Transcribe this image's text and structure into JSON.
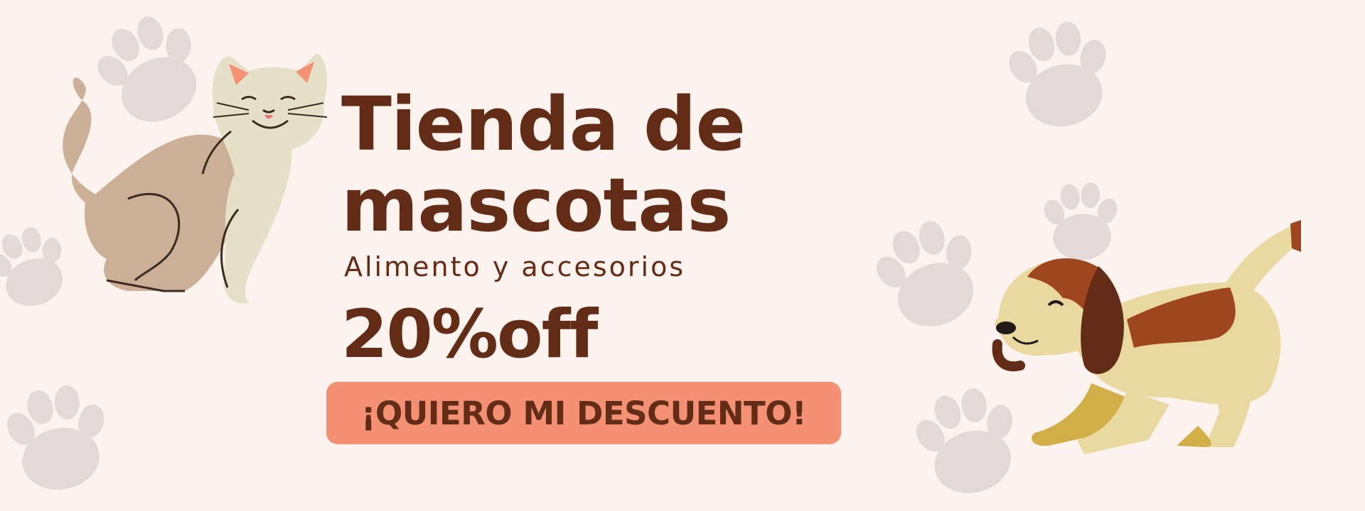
{
  "banner": {
    "title_line1": "Tienda de",
    "title_line2": "mascotas",
    "subtitle": "Alimento y accesorios",
    "offer": "20%off",
    "cta_label": "¡QUIERO MI DESCUENTO!"
  },
  "colors": {
    "background": "#fcf2ee",
    "text": "#622c17",
    "cta_background": "#f49074",
    "paw_prints": "#e2d9d8"
  },
  "illustrations": [
    "cat-illustration",
    "dog-illustration",
    "paw-print-icon"
  ]
}
